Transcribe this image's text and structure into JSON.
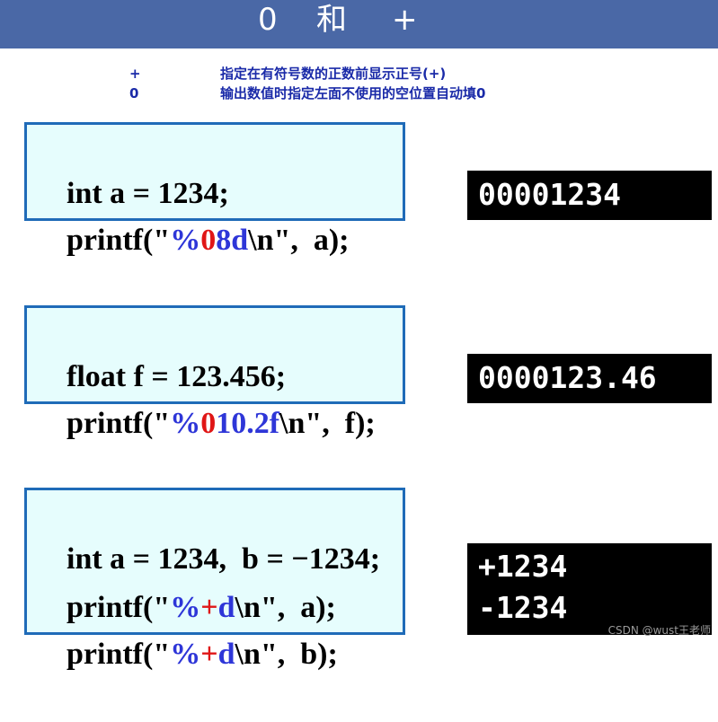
{
  "header": {
    "title_parts": [
      "0",
      "和",
      "+"
    ]
  },
  "legend": [
    {
      "flag": "+",
      "desc": "指定在有符号数的正数前显示正号(+)"
    },
    {
      "flag": "0",
      "desc": "输出数值时指定左面不使用的空位置自动填0"
    }
  ],
  "examples": [
    {
      "code": [
        {
          "pre": "int a = 1234;",
          "fmt_open": "",
          "flag": "",
          "fmt_rest": "",
          "post": ""
        },
        {
          "pre": "printf(\"",
          "fmt_open": "%",
          "flag": "0",
          "fmt_rest": "8d",
          "post": "\\n\",  a);"
        }
      ],
      "output": [
        "00001234"
      ]
    },
    {
      "code": [
        {
          "pre": "float f = 123.456;",
          "fmt_open": "",
          "flag": "",
          "fmt_rest": "",
          "post": ""
        },
        {
          "pre": "printf(\"",
          "fmt_open": "%",
          "flag": "0",
          "fmt_rest": "10.2f",
          "post": "\\n\",  f);"
        }
      ],
      "output": [
        "0000123.46"
      ]
    },
    {
      "code": [
        {
          "pre": "int a = 1234,  b = −1234;",
          "fmt_open": "",
          "flag": "",
          "fmt_rest": "",
          "post": ""
        },
        {
          "pre": "printf(\"",
          "fmt_open": "%",
          "flag": "+",
          "fmt_rest": "d",
          "post": "\\n\",  a);"
        },
        {
          "pre": "printf(\"",
          "fmt_open": "%",
          "flag": "+",
          "fmt_rest": "d",
          "post": "\\n\",  b);"
        }
      ],
      "output": [
        "+1234",
        "-1234"
      ]
    }
  ],
  "watermark": "CSDN @wust王老师",
  "colors": {
    "header_bg": "#4a68a6",
    "legend_text": "#1a2aa8",
    "code_bg": "#e6fdfd",
    "code_border": "#1f6bb8",
    "format_blue": "#2e36d8",
    "flag_red": "#e01616",
    "output_bg": "#000000"
  }
}
